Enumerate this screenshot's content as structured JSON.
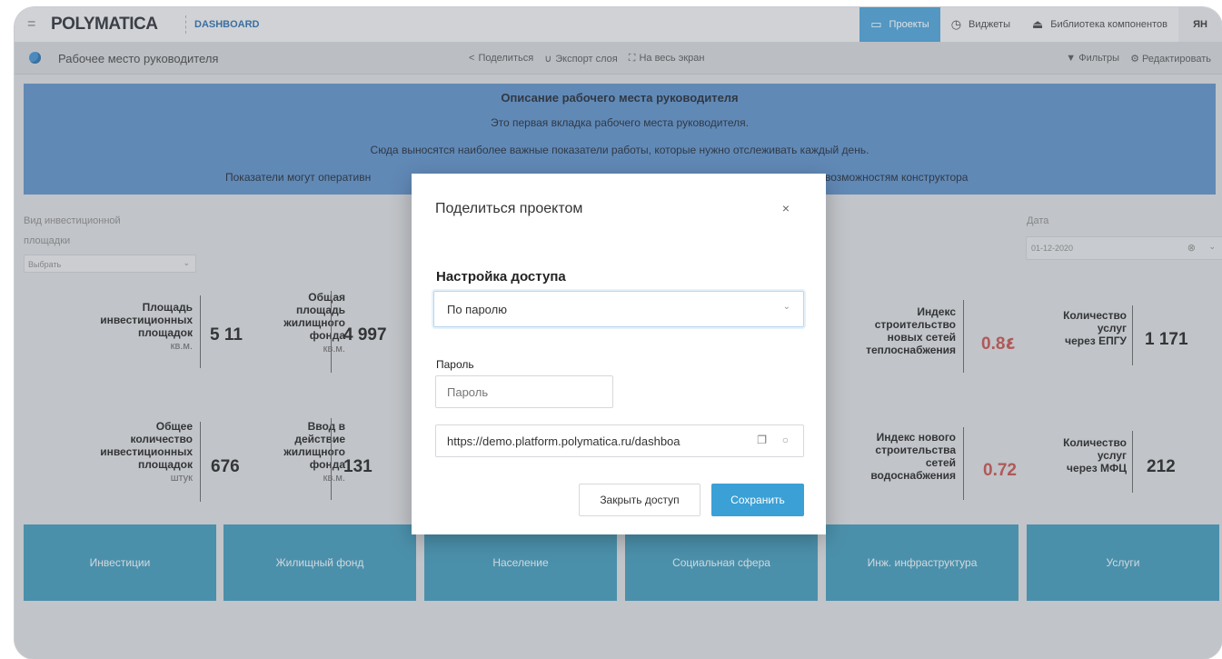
{
  "app": {
    "logo": "POLYMATICA",
    "section": "DASHBOARD",
    "nav": [
      {
        "label": "Проекты",
        "icon": "monitor-icon"
      },
      {
        "label": "Виджеты",
        "icon": "clock-icon"
      },
      {
        "label": "Библиотека компонентов",
        "icon": "eject-icon"
      }
    ],
    "user_initials": "ЯН"
  },
  "toolbar": {
    "workspace_title": "Рабочее место руководителя",
    "share": "Поделиться",
    "export": "Экспорт слоя",
    "fullscreen": "На весь экран",
    "filters": "Фильтры",
    "edit": "Редактировать"
  },
  "banner": {
    "title": "Описание рабочего места руководителя",
    "line1": "Это первая вкладка рабочего места руководителя.",
    "line2": "Сюда выносятся наиболее важные показатели работы, которые нужно отслеживать каждый день.",
    "line3_left": "Показатели могут оперативн",
    "line3_right": "возможностям конструктора"
  },
  "filters": {
    "investment_label_1": "Вид инвестиционной",
    "investment_label_2": "площадки",
    "investment_placeholder": "Выбрать",
    "date_label": "Дата",
    "date_value": "01-12-2020"
  },
  "kpis": [
    {
      "name_lines": [
        "Площадь",
        "инвестиционных",
        "площадок"
      ],
      "unit": "кв.м.",
      "value": "5 11"
    },
    {
      "name_lines": [
        "Общая",
        "площадь",
        "жилищного",
        "фонда"
      ],
      "unit": "кв.м.",
      "value": "4 997"
    },
    {
      "name_lines": [
        "Общее",
        "количество",
        "инвестиционных",
        "площадок"
      ],
      "unit": "штук",
      "value": "676"
    },
    {
      "name_lines": [
        "Ввод в",
        "действие",
        "жилищного",
        "фонда"
      ],
      "unit": "кв.м.",
      "value": "131"
    },
    {
      "name_lines": [
        "Индекс",
        "строительство",
        "новых сетей",
        "теплоснабжения"
      ],
      "unit": "",
      "value": "0.8٤"
    },
    {
      "name_lines": [
        "Количество",
        "услуг",
        "через ЕПГУ"
      ],
      "unit": "",
      "value": "1 171"
    },
    {
      "name_lines": [
        "Индекс нового",
        "строительства",
        "сетей",
        "водоснабжения"
      ],
      "unit": "",
      "value": "0.72"
    },
    {
      "name_lines": [
        "Количество",
        "услуг",
        "через МФЦ"
      ],
      "unit": "",
      "value": "212"
    }
  ],
  "tiles": [
    "Инвестиции",
    "Жилищный фонд",
    "Население",
    "Социальная сфера",
    "Инж. инфраструктура",
    "Услуги"
  ],
  "modal": {
    "title": "Поделиться проектом",
    "section": "Настройка доступа",
    "access_mode": "По паролю",
    "password_label": "Пароль",
    "password_placeholder": "Пароль",
    "link": "https://demo.platform.polymatica.ru/dashboa",
    "close_access": "Закрыть доступ",
    "save": "Сохранить"
  },
  "colors": {
    "accent": "#3aa0d6",
    "banner": "#5b8ec5",
    "tile": "#3f97b6",
    "kpi_red": "#c0504d"
  }
}
